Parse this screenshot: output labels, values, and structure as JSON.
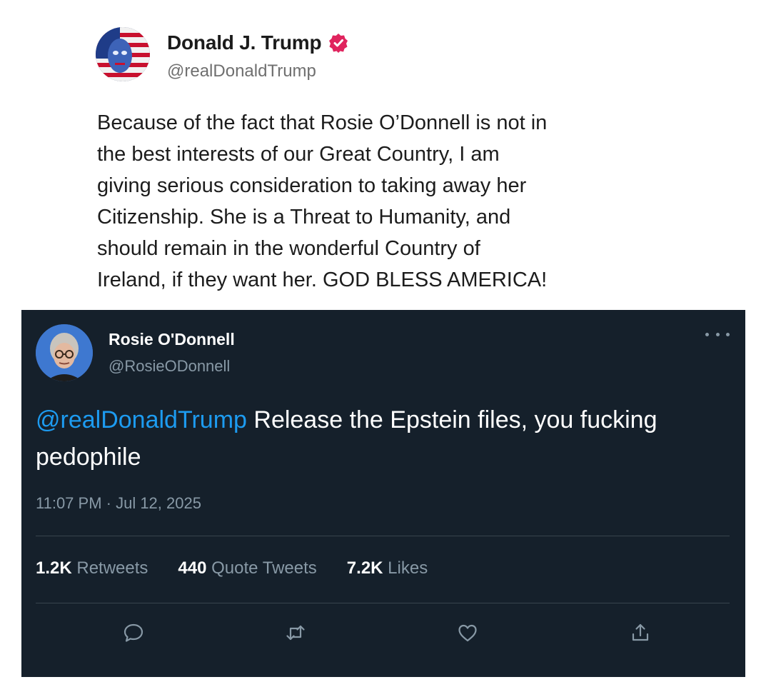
{
  "post": {
    "author": {
      "display_name": "Donald J. Trump",
      "handle": "@realDonaldTrump",
      "verified": true,
      "verified_color": "#e0245e"
    },
    "body": "Because of the fact that Rosie O’Donnell is not in\nthe best interests of our Great Country, I am\ngiving serious consideration to taking away her\nCitizenship. She is a Threat to Humanity, and\nshould remain in the wonderful Country of\nIreland, if they want her. GOD BLESS AMERICA!"
  },
  "tweet": {
    "author": {
      "display_name": "Rosie O'Donnell",
      "handle": "@RosieODonnell"
    },
    "mention": "@realDonaldTrump",
    "text": " Release the Epstein files, you fucking pedophile",
    "timestamp": "11:07 PM · Jul 12, 2025",
    "stats": {
      "retweets_count": "1.2K",
      "retweets_label": "Retweets",
      "quotes_count": "440",
      "quotes_label": "Quote Tweets",
      "likes_count": "7.2K",
      "likes_label": "Likes"
    },
    "actions": [
      "reply-icon",
      "retweet-icon",
      "like-icon",
      "share-icon"
    ],
    "colors": {
      "background": "#15202b",
      "mention": "#1d9bf0",
      "secondary_text": "#8899a6"
    }
  }
}
